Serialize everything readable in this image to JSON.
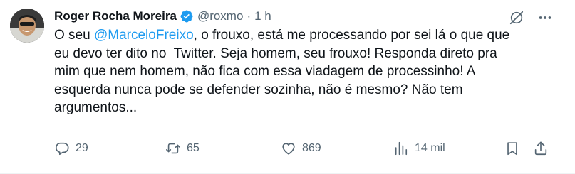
{
  "author": {
    "name": "Roger Rocha Moreira",
    "handle": "@roxmo",
    "separator": "·",
    "time": "1 h",
    "verified_color": "#1d9bf0"
  },
  "tweet": {
    "text_before": "O seu ",
    "mention": "@MarceloFreixo",
    "text_after": ", o frouxo, está me processando por sei lá o que que\neu devo ter dito no  Twitter. Seja homem, seu frouxo! Responda direto pra\nmim que nem homem, não fica com essa viadagem de processinho! A\nesquerda nunca pode se defender sozinha, não é mesmo? Não tem\nargumentos..."
  },
  "actions": {
    "replies": "29",
    "reposts": "65",
    "likes": "869",
    "views": "14 mil"
  },
  "icons": {
    "grok": "grok-icon",
    "more": "more-dots-icon",
    "reply": "reply-icon",
    "repost": "repost-icon",
    "like": "heart-icon",
    "views": "views-chart-icon",
    "bookmark": "bookmark-icon",
    "share": "share-icon"
  },
  "colors": {
    "text": "#0f1419",
    "secondary": "#536471",
    "link": "#1d9bf0"
  }
}
